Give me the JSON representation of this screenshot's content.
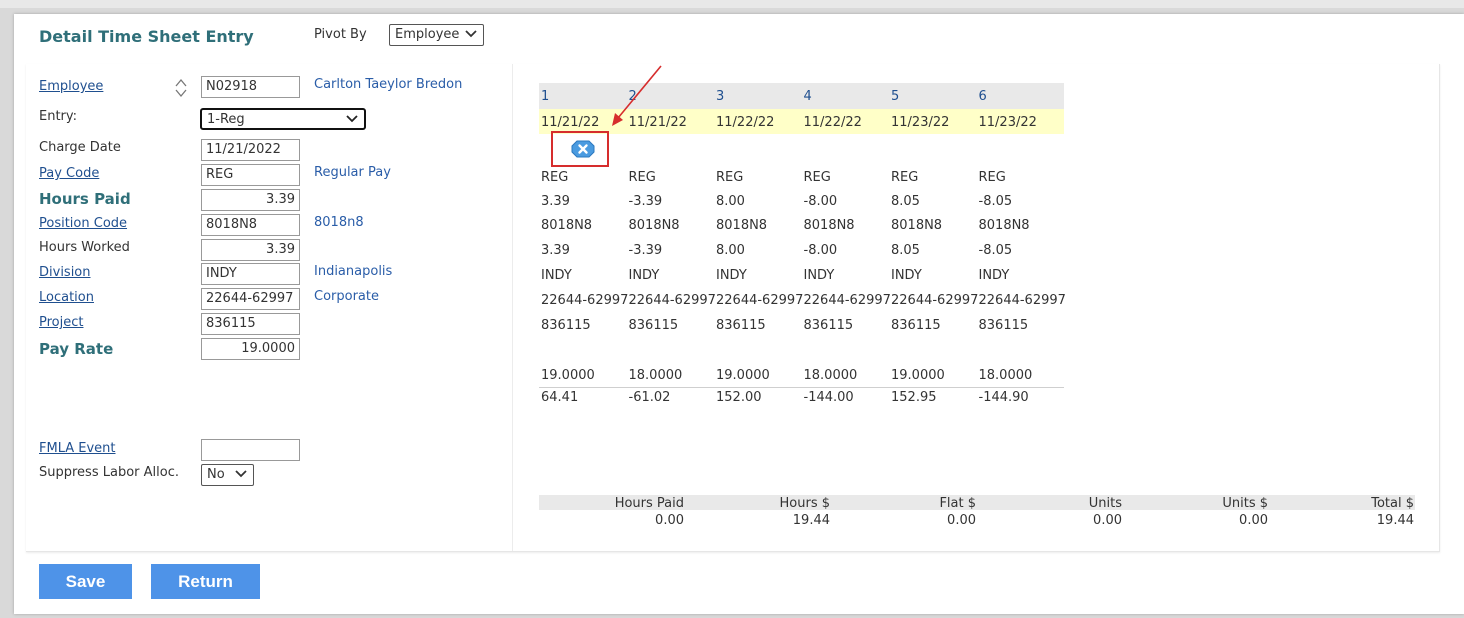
{
  "header": {
    "title": "Detail Time Sheet Entry",
    "pivot_label": "Pivot By",
    "pivot_value": "Employee"
  },
  "form": {
    "employee": {
      "label": "Employee",
      "value": "N02918",
      "desc": "Carlton Taeylor Bredon"
    },
    "entry": {
      "label": "Entry:",
      "value": "1-Reg"
    },
    "charge_date": {
      "label": "Charge Date",
      "value": "11/21/2022"
    },
    "pay_code": {
      "label": "Pay Code",
      "value": "REG",
      "desc": "Regular Pay"
    },
    "hours_paid": {
      "label": "Hours Paid",
      "value": "3.39"
    },
    "position_code": {
      "label": "Position Code",
      "value": "8018N8",
      "desc": "8018n8"
    },
    "hours_worked": {
      "label": "Hours Worked",
      "value": "3.39"
    },
    "division": {
      "label": "Division",
      "value": "INDY",
      "desc": "Indianapolis"
    },
    "location": {
      "label": "Location",
      "value": "22644-62997",
      "desc": "Corporate"
    },
    "project": {
      "label": "Project",
      "value": "836115"
    },
    "pay_rate": {
      "label": "Pay Rate",
      "value": "19.0000"
    },
    "fmla": {
      "label": "FMLA Event",
      "value": ""
    },
    "suppress": {
      "label": "Suppress Labor Alloc.",
      "value": "No"
    }
  },
  "grid": {
    "columns": [
      "1",
      "2",
      "3",
      "4",
      "5",
      "6"
    ],
    "dates": [
      "11/21/22",
      "11/21/22",
      "11/22/22",
      "11/22/22",
      "11/23/22",
      "11/23/22"
    ],
    "rows": [
      [
        "REG",
        "REG",
        "REG",
        "REG",
        "REG",
        "REG"
      ],
      [
        "3.39",
        "-3.39",
        "8.00",
        "-8.00",
        "8.05",
        "-8.05"
      ],
      [
        "8018N8",
        "8018N8",
        "8018N8",
        "8018N8",
        "8018N8",
        "8018N8"
      ],
      [
        "3.39",
        "-3.39",
        "8.00",
        "-8.00",
        "8.05",
        "-8.05"
      ],
      [
        "INDY",
        "INDY",
        "INDY",
        "INDY",
        "INDY",
        "INDY"
      ],
      [
        "22644-62997",
        "22644-62997",
        "22644-62997",
        "22644-62997",
        "22644-62997",
        "22644-62997"
      ],
      [
        "836115",
        "836115",
        "836115",
        "836115",
        "836115",
        "836115"
      ],
      [
        "19.0000",
        "18.0000",
        "19.0000",
        "18.0000",
        "19.0000",
        "18.0000"
      ],
      [
        "64.41",
        "-61.02",
        "152.00",
        "-144.00",
        "152.95",
        "-144.90"
      ]
    ]
  },
  "totals": {
    "headers": [
      "Hours Paid",
      "Hours $",
      "Flat $",
      "Units",
      "Units $",
      "Total $"
    ],
    "values": [
      "0.00",
      "19.44",
      "0.00",
      "0.00",
      "0.00",
      "19.44"
    ]
  },
  "buttons": {
    "save": "Save",
    "return": "Return"
  },
  "colors": {
    "accent": "#4e93e8",
    "title": "#2f6f79",
    "link": "#1f4f8f",
    "highlight": "#ffffc8",
    "annotation": "#d62d2d"
  }
}
